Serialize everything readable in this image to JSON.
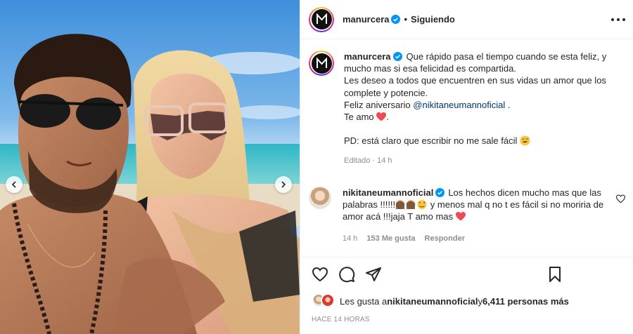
{
  "header": {
    "username": "manurcera",
    "separator": "•",
    "follow_label": "Siguiendo"
  },
  "caption": {
    "username": "manurcera",
    "lines": [
      "Que rápido pasa el tiempo cuando se esta feliz, y mucho mas si esa felicidad es compartida.",
      "Les deseo a todos que encuentren en sus vidas un amor que los complete y potencie.",
      "Feliz aniversario",
      "Te amo",
      "",
      "PD: está claro que escribir no me sale fácil"
    ],
    "mention": "@nikitaneumannoficial",
    "mention_suffix": " .",
    "te_amo_suffix": ".",
    "edited": "Editado",
    "edited_sep": "·",
    "time": "14 h"
  },
  "comment": {
    "username": "nikitaneumannoficial",
    "text_1": "Los hechos dicen mucho mas que las palabras !!!!!!",
    "text_2": " y menos mal q no t es fácil si no moriria de amor acá !!!jaja T amo mas",
    "time": "14 h",
    "likes": "153 Me gusta",
    "reply": "Responder"
  },
  "likes": {
    "prefix": "Les gusta a ",
    "user": "nikitaneumannoficial",
    "middle": " y ",
    "others": "6,411 personas más"
  },
  "timestamp": "Hace 14 horas",
  "colors": {
    "verified": "#0095f6",
    "heart_red": "#ed4956",
    "mention": "#00376b",
    "meta_gray": "#8e8e8e"
  }
}
